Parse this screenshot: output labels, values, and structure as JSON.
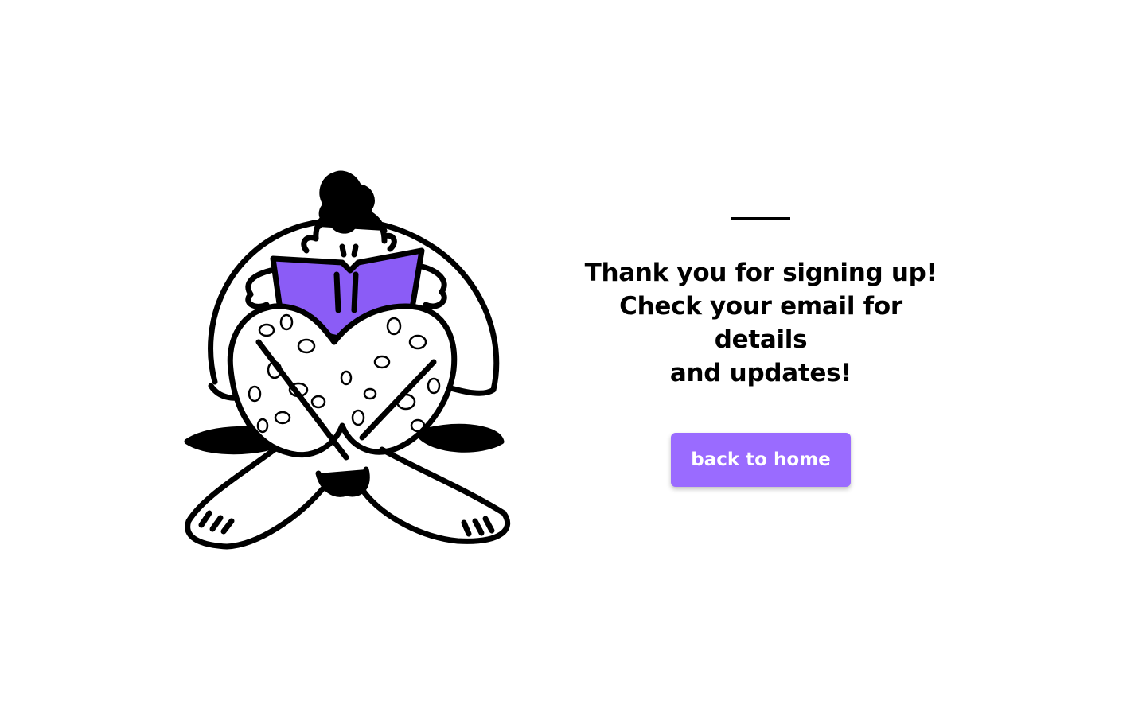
{
  "message": {
    "line1": "Thank you for signing up!",
    "line2": "Check your email for details",
    "line3": "and updates!"
  },
  "cta": {
    "label": "back to home"
  },
  "illustration": {
    "subject": "person-reading-book-illustration",
    "accent_color": "#8b5cf6"
  },
  "colors": {
    "button": "#9a6bff",
    "text": "#000000",
    "background": "#ffffff"
  }
}
